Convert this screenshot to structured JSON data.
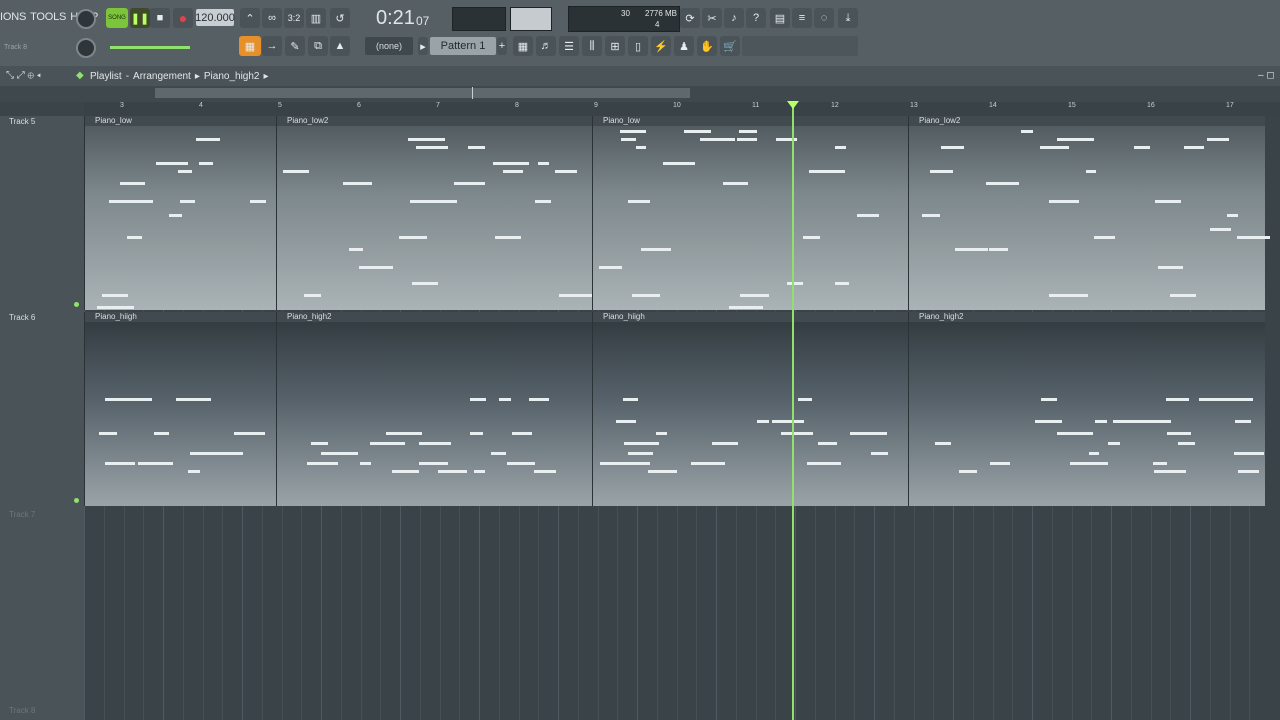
{
  "menu": {
    "items": [
      "IONS",
      "TOOLS",
      "HELP"
    ]
  },
  "transport": {
    "song_label": "SONG",
    "tempo": "120.000",
    "time": "0:21",
    "time_small": "07",
    "cpu": "30",
    "ram": "2776 MB",
    "voices": "4"
  },
  "pattern": {
    "current": "Pattern 1",
    "selector": "(none)"
  },
  "breadcrumb": {
    "items": [
      "Playlist",
      "Arrangement",
      "Piano_high2"
    ]
  },
  "ruler": {
    "bars": [
      "3",
      "4",
      "5",
      "6",
      "7",
      "8",
      "9",
      "10",
      "11",
      "12",
      "13",
      "14",
      "15",
      "16",
      "17"
    ]
  },
  "tracks": [
    {
      "name": "Track 5",
      "clips": [
        {
          "name": "Piano_low"
        },
        {
          "name": "Piano_low2"
        },
        {
          "name": "Piano_low"
        },
        {
          "name": "Piano_low2"
        }
      ]
    },
    {
      "name": "Track 6",
      "clips": [
        {
          "name": "Piano_hiigh"
        },
        {
          "name": "Piano_high2"
        },
        {
          "name": "Piano_hiigh"
        },
        {
          "name": "Piano_high2"
        }
      ]
    },
    {
      "name": "Track 7",
      "clips": []
    },
    {
      "name": "Track 8",
      "clips": []
    }
  ],
  "mini_track_label": "Track 8"
}
